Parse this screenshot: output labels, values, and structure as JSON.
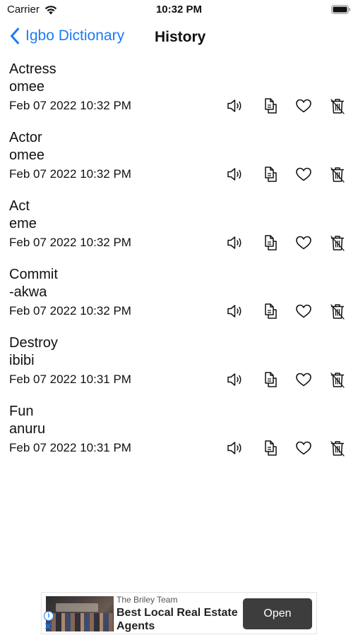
{
  "status_bar": {
    "carrier": "Carrier",
    "time": "10:32 PM"
  },
  "nav": {
    "back_label": "Igbo Dictionary",
    "title": "History"
  },
  "colors": {
    "accent": "#1a7cf5",
    "ad_button": "#3d3d3d"
  },
  "history": [
    {
      "word": "Actress",
      "translation": "omee",
      "date": "Feb 07 2022 10:32 PM"
    },
    {
      "word": "Actor",
      "translation": "omee",
      "date": "Feb 07 2022 10:32 PM"
    },
    {
      "word": "Act",
      "translation": "eme",
      "date": "Feb 07 2022 10:32 PM"
    },
    {
      "word": "Commit",
      "translation": "-akwa",
      "date": "Feb 07 2022 10:32 PM"
    },
    {
      "word": "Destroy",
      "translation": "ibibi",
      "date": "Feb 07 2022 10:31 PM"
    },
    {
      "word": "Fun",
      "translation": "anuru",
      "date": "Feb 07 2022 10:31 PM"
    }
  ],
  "row_actions": [
    "speaker-icon",
    "copy-icon",
    "heart-icon",
    "trash-icon"
  ],
  "ad": {
    "sponsor": "The Briley Team",
    "headline": "Best Local Real Estate Agents",
    "button_label": "Open"
  }
}
